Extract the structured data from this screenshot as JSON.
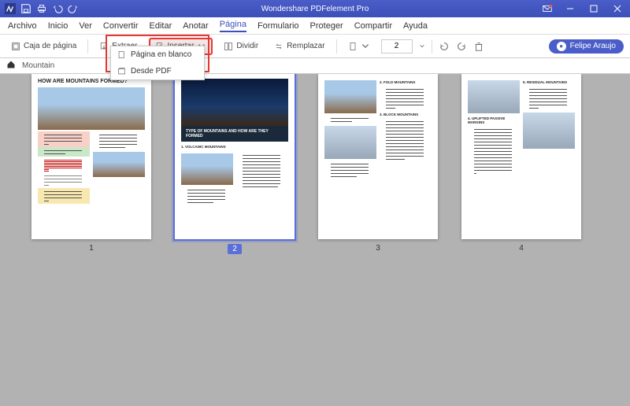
{
  "titlebar": {
    "title": "Wondershare PDFelement Pro"
  },
  "menu": {
    "items": [
      "Archivo",
      "Inicio",
      "Ver",
      "Convertir",
      "Editar",
      "Anotar",
      "Página",
      "Formulario",
      "Proteger",
      "Compartir",
      "Ayuda"
    ],
    "active_index": 6
  },
  "toolbar": {
    "pagebox": "Caja de página",
    "extract": "Extraer",
    "insert": "Insertar",
    "split": "Dividir",
    "replace": "Remplazar",
    "page_value": "2"
  },
  "dropdown": {
    "blank": "Página en blanco",
    "frompdf": "Desde PDF"
  },
  "user": {
    "name": "Felipe Araujo"
  },
  "breadcrumb": {
    "doc": "Mountain"
  },
  "pages": {
    "nums": [
      "1",
      "2",
      "3",
      "4"
    ],
    "selected_index": 1,
    "p1_title": "HOW ARE MOUNTAINS FORMED?",
    "p2_band": "TYPE OF MOUNTAINS AND HOW ARE THEY FORMED",
    "p2_sub": "1. VOLCANIC MOUNTAINS",
    "p3_s1": "2. FOLD MOUNTAINS",
    "p3_s2": "3. BLOCK MOUNTAINS",
    "p4_s1": "4. UPLIFTED PASSIVE MARGINS",
    "p4_s2": "5. RESIDUAL MOUNTAINS"
  }
}
